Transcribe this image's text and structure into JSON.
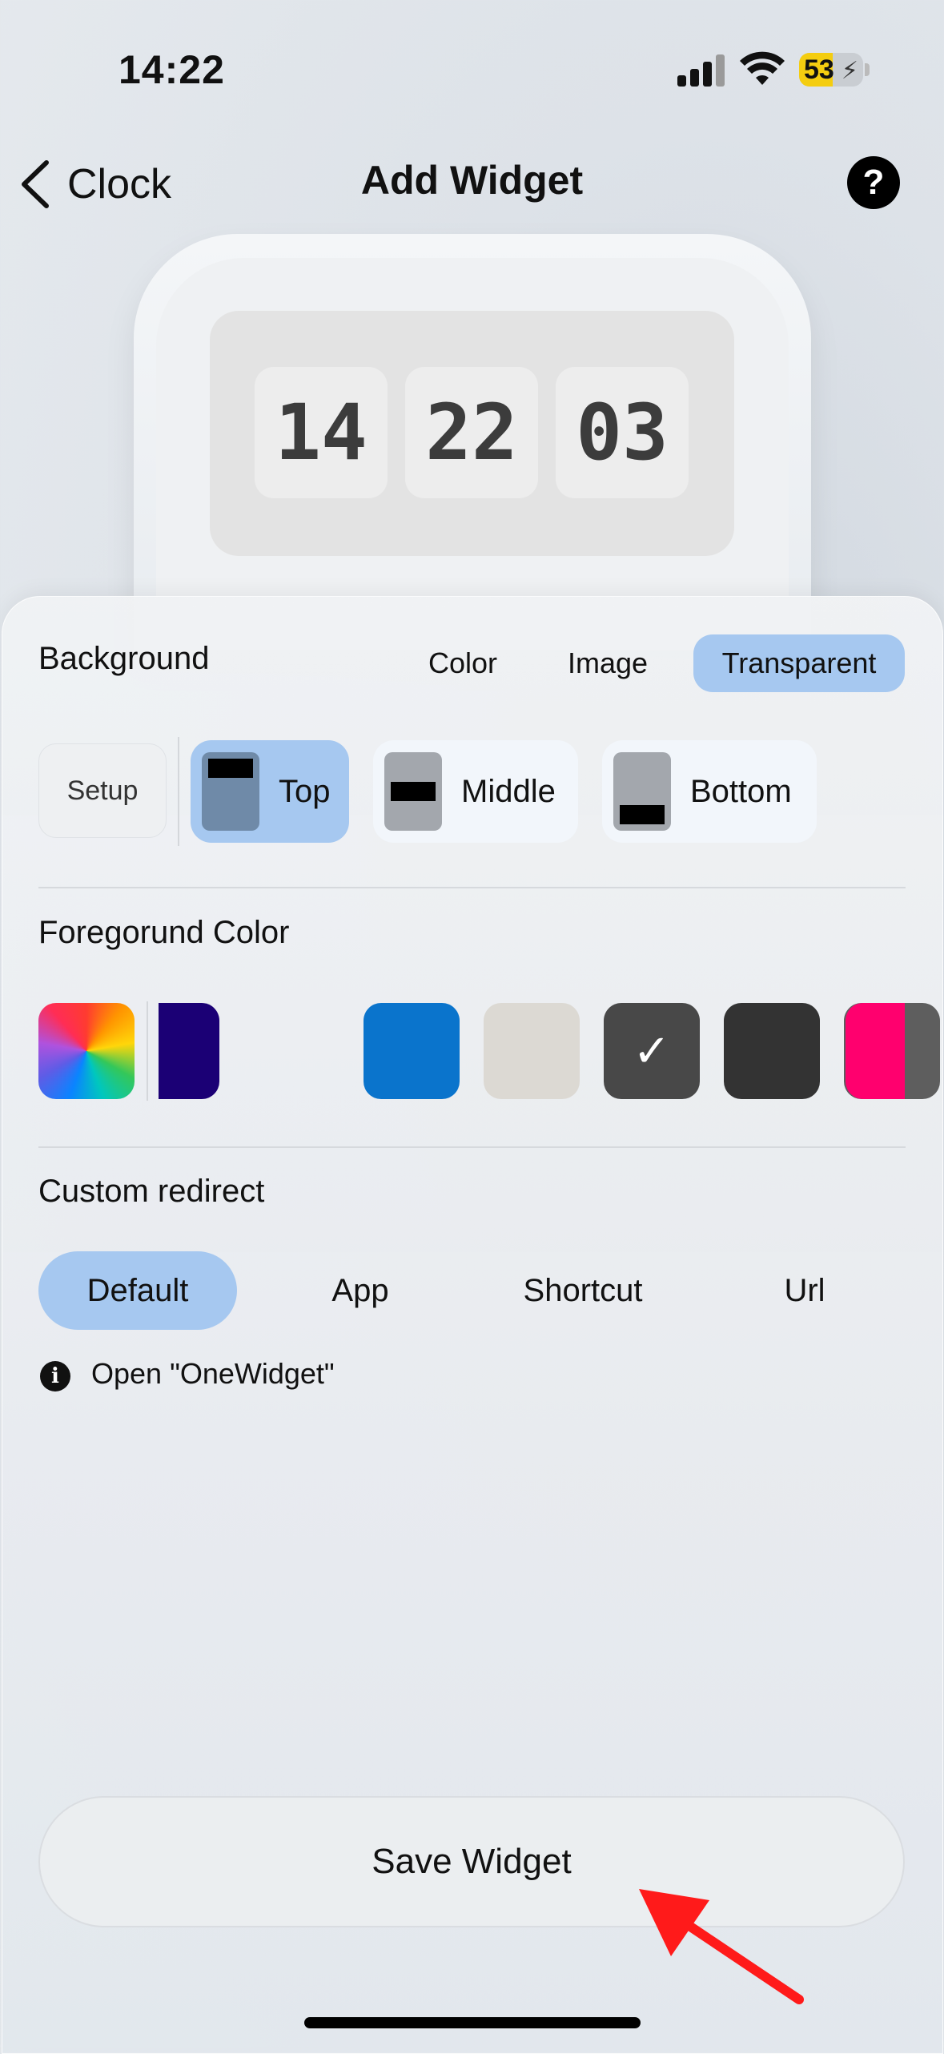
{
  "status": {
    "time": "14:22",
    "battery": "53"
  },
  "nav": {
    "back_label": "Clock",
    "title": "Add Widget",
    "help": "?"
  },
  "preview": {
    "hours": "14",
    "minutes": "22",
    "seconds": "03"
  },
  "background": {
    "label": "Background",
    "options": [
      "Color",
      "Image",
      "Transparent"
    ],
    "selected": "Transparent",
    "setup_label": "Setup",
    "positions": [
      "Top",
      "Middle",
      "Bottom"
    ],
    "selected_position": "Top"
  },
  "foreground": {
    "label": "Foregorund Color",
    "swatches": [
      "rainbow",
      "#1b0075",
      "#0a74cc",
      "#dcd9d3",
      "#484848",
      "#333333",
      "#5e5e5e",
      "#ff006e"
    ],
    "selected_index": 4,
    "check": "✓"
  },
  "redirect": {
    "label": "Custom redirect",
    "options": [
      "Default",
      "App",
      "Shortcut",
      "Url"
    ],
    "selected": "Default",
    "info": "Open \"OneWidget\""
  },
  "save_label": "Save Widget",
  "colors": {
    "accent": "#a6c8f0",
    "annotation_arrow": "#ff1a1a"
  }
}
